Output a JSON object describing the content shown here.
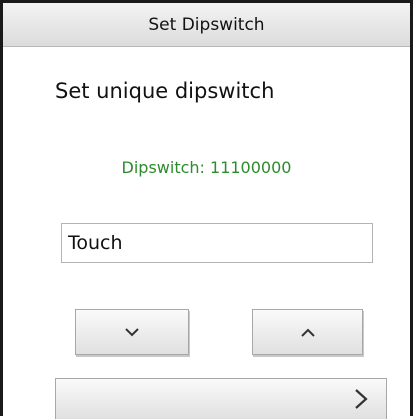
{
  "window": {
    "title": "Set Dipswitch"
  },
  "main": {
    "heading": "Set unique dipswitch",
    "status_text": "Dipswitch: 11100000",
    "input_value": "Touch"
  },
  "buttons": {
    "down": {
      "icon": "chevron-down-icon"
    },
    "up": {
      "icon": "chevron-up-icon"
    },
    "next": {
      "icon": "chevron-right-icon"
    }
  },
  "colors": {
    "status_text": "#2e8b2e",
    "title_bar": "#e6e6e6",
    "border": "#1a1a1a"
  }
}
